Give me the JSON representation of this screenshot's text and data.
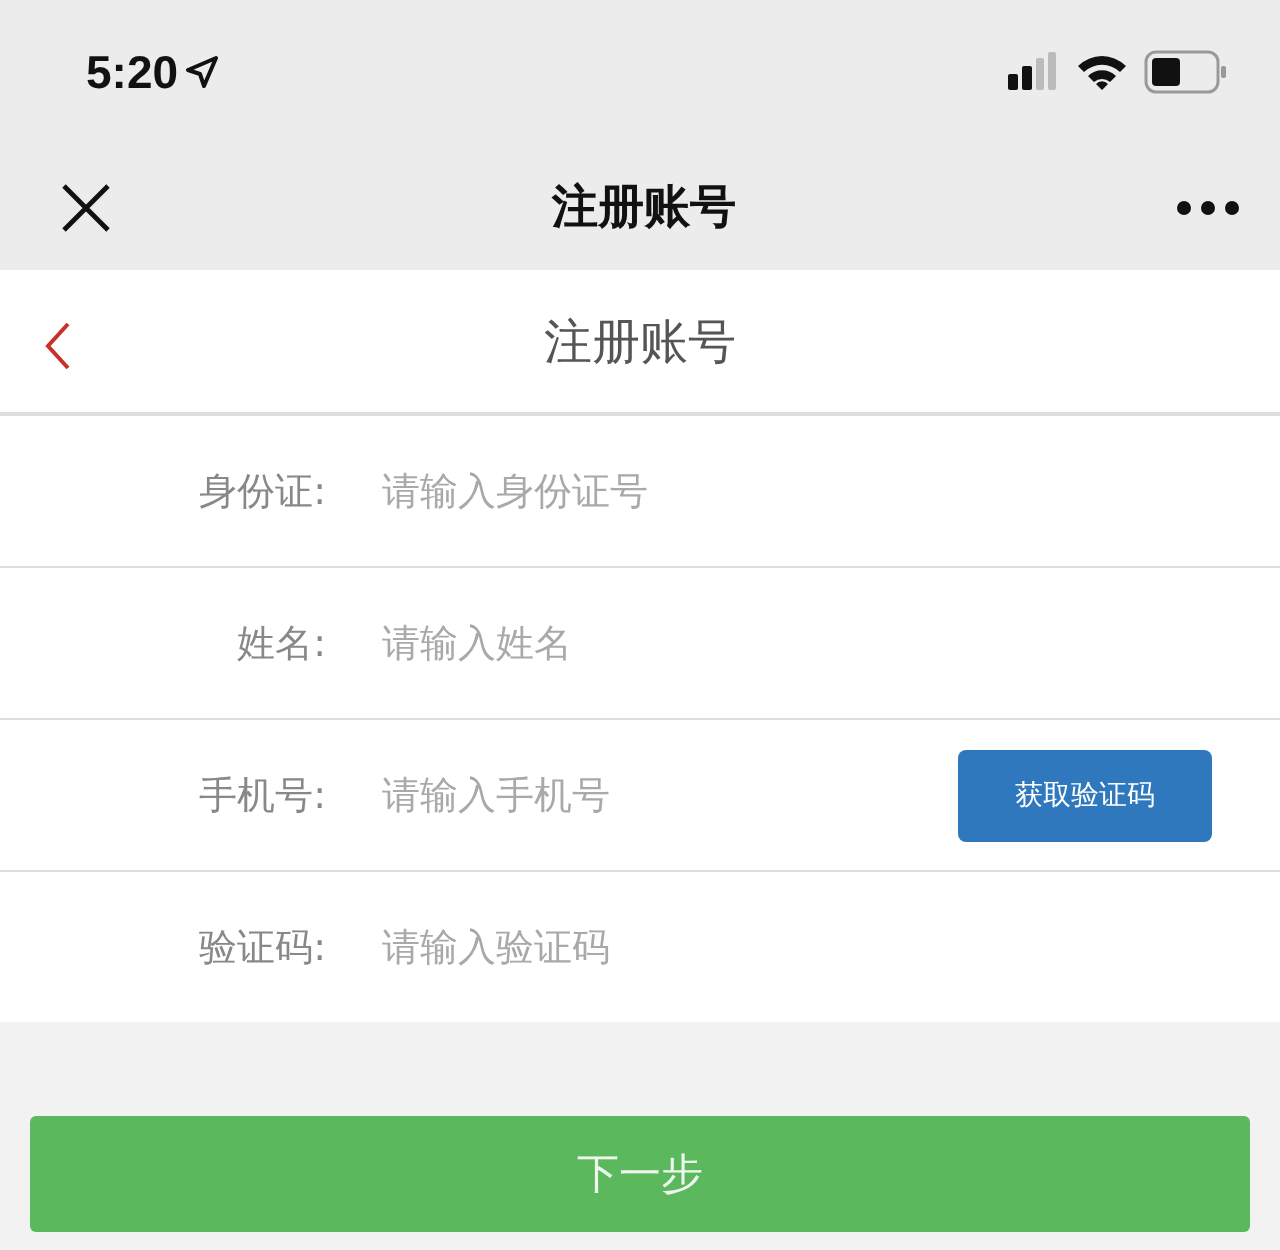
{
  "status_bar": {
    "time": "5:20"
  },
  "nav_bar": {
    "title": "注册账号"
  },
  "header": {
    "title": "注册账号"
  },
  "form": {
    "rows": [
      {
        "label": "身份证:",
        "placeholder": "请输入身份证号"
      },
      {
        "label": "姓名:",
        "placeholder": "请输入姓名"
      },
      {
        "label": "手机号:",
        "placeholder": "请输入手机号",
        "button": "获取验证码"
      },
      {
        "label": "验证码:",
        "placeholder": "请输入验证码"
      }
    ]
  },
  "next_button": "下一步"
}
